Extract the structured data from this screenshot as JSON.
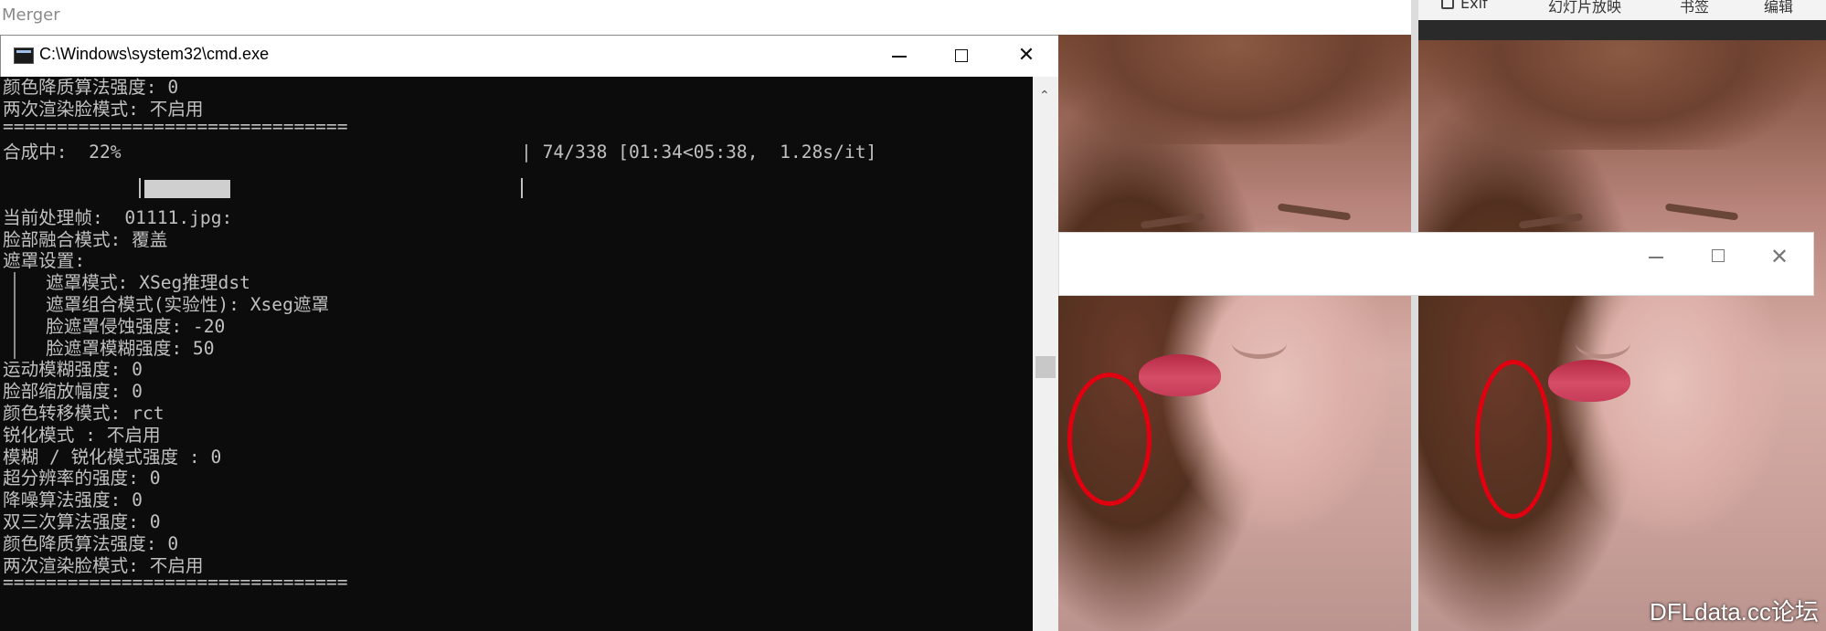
{
  "background_window": {
    "title": "Merger"
  },
  "right_toolbar": {
    "items": [
      "Exif",
      "幻灯片放映",
      "书签",
      "编辑"
    ]
  },
  "cmd": {
    "title": "C:\\Windows\\system32\\cmd.exe",
    "close_glyph": "✕",
    "progress": {
      "label": "合成中:  22%",
      "fraction": 0.22,
      "stats": "| 74/338 [01:34<05:38,  1.28s/it]"
    },
    "lines": [
      "颜色降质算法强度: 0",
      "两次渲染脸模式: 不启用",
      "================================",
      "",
      "",
      "当前处理帧:  01111.jpg:",
      "脸部融合模式: 覆盖",
      "遮罩设置:",
      "    遮罩模式: XSeg推理dst",
      "    遮罩组合模式(实验性): Xseg遮罩",
      "    脸遮罩侵蚀强度: -20",
      "    脸遮罩模糊强度: 50",
      "运动模糊强度: 0",
      "脸部缩放幅度: 0",
      "颜色转移模式: rct",
      "锐化模式 : 不启用",
      "模糊 / 锐化模式强度 : 0",
      "超分辨率的强度: 0",
      "降噪算法强度: 0",
      "双三次算法强度: 0",
      "颜色降质算法强度: 0",
      "两次渲染脸模式: 不启用",
      "================================"
    ]
  },
  "float_window": {
    "close_glyph": "✕"
  },
  "watermark": "DFLdata.cc论坛",
  "colors": {
    "console_bg": "#0c0c0c",
    "console_text": "#c0c0c0",
    "highlight_ring": "#e00010"
  }
}
